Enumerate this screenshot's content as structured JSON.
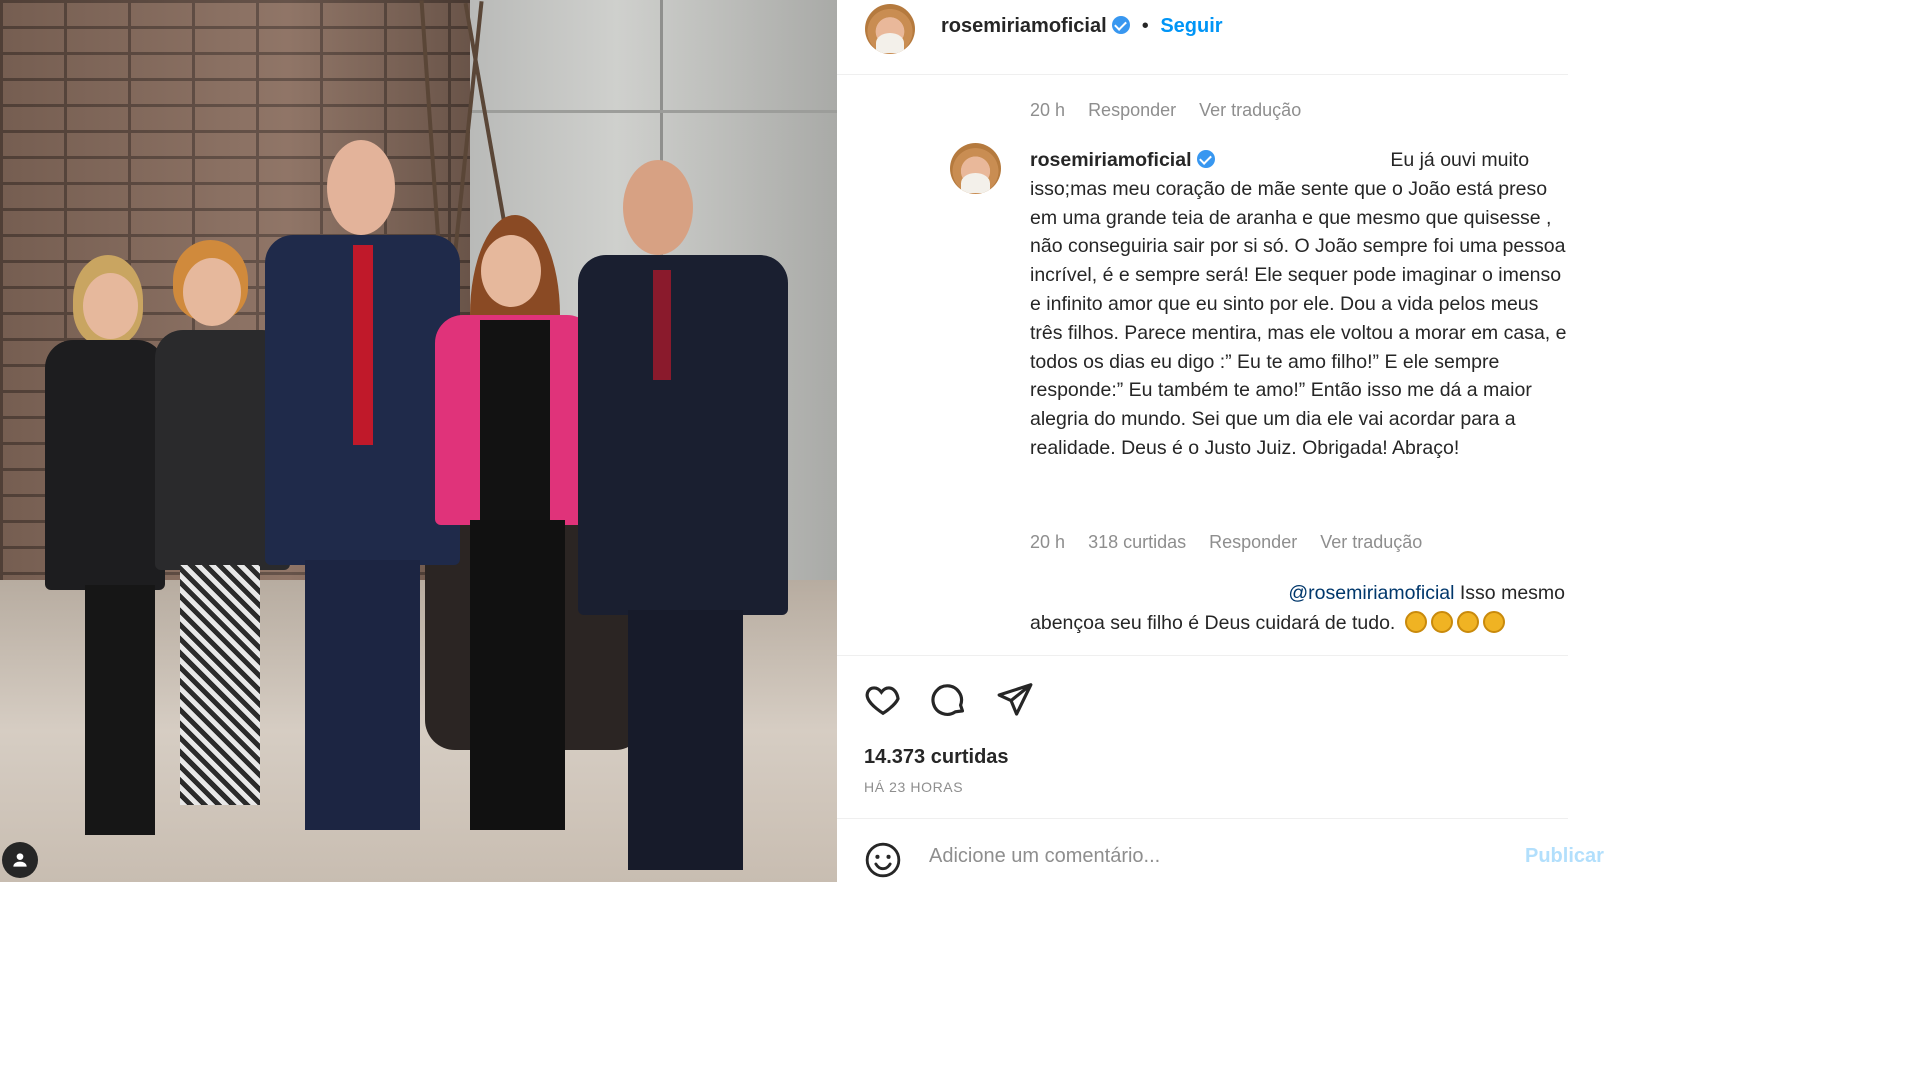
{
  "post": {
    "author": "rosemiriamoficial",
    "separator": "•",
    "follow_label": "Seguir"
  },
  "prev_comment": {
    "time": "20 h",
    "reply_label": "Responder",
    "translate_label": "Ver tradução"
  },
  "comment": {
    "author": "rosemiriamoficial",
    "text": "Eu já ouvi muito isso;mas meu coração de mãe sente que o João está preso em uma grande teia de aranha e que mesmo que quisesse , não conseguiria sair por si só. O João sempre foi uma pessoa incrível, é e sempre será! Ele sequer pode imaginar o imenso e infinito amor que eu sinto por ele. Dou a vida pelos meus três filhos. Parece mentira, mas ele voltou a morar em casa, e todos os dias eu digo :” Eu te amo filho!” E ele sempre responde:” Eu também te amo!” Então isso me dá a maior alegria do mundo. Sei que um dia ele vai acordar para a realidade. Deus é o Justo Juiz. Obrigada! Abraço!",
    "time": "20 h",
    "likes": "318 curtidas",
    "reply_label": "Responder",
    "translate_label": "Ver tradução"
  },
  "reply": {
    "mention": "@rosemiriamoficial",
    "text_line1": "Isso mesmo",
    "text_line2": "abençoa seu filho é Deus cuidará de tudo."
  },
  "stats": {
    "likes": "14.373 curtidas",
    "ago": "HÁ 23 HORAS"
  },
  "add_comment": {
    "placeholder": "Adicione um comentário...",
    "publish_label": "Publicar"
  },
  "icons": {
    "like": "heart-icon",
    "comment": "speech-bubble-icon",
    "share": "paper-plane-icon",
    "emoji": "smiley-icon",
    "verified": "verified-badge-icon",
    "tag": "user-tag-icon"
  },
  "colors": {
    "link": "#0095f6",
    "verified": "#3897f0",
    "muted": "#8e8e8e",
    "mention": "#00376b"
  }
}
